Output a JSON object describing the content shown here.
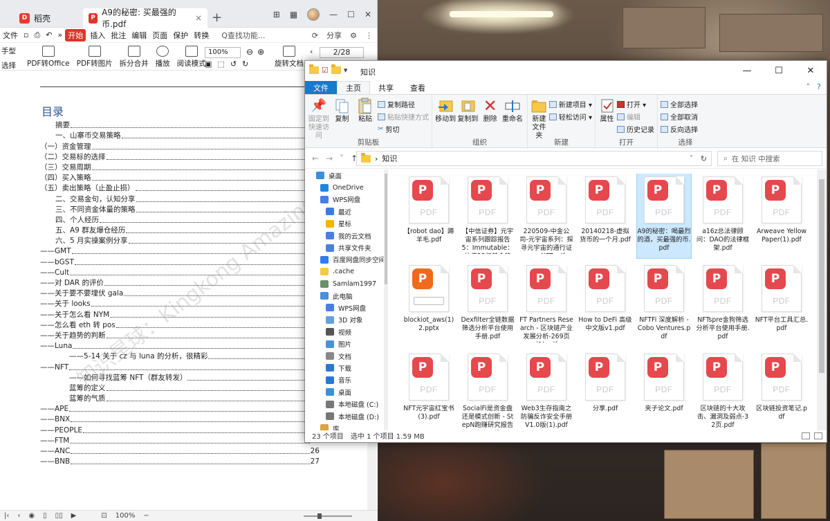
{
  "wps": {
    "tabs": [
      {
        "label": "稻壳",
        "icon": "docer-icon"
      },
      {
        "label": "A9的秘密:      买最强的币.pdf",
        "icon": "pdf-icon"
      }
    ],
    "new_tab": "+",
    "menu": {
      "file": "文件",
      "items": [
        "开始",
        "插入",
        "批注",
        "编辑",
        "页面",
        "保护",
        "转换"
      ],
      "search": "Q查找功能...",
      "share": "分享",
      "expand": "»"
    },
    "ribbon": {
      "hand": "手型",
      "select": "选择",
      "buttons": [
        "PDF转Office",
        "PDF转图片",
        "拆分合并",
        "播放",
        "阅读模式",
        "旋转文档"
      ],
      "zoom": "100%",
      "page": "2/28"
    },
    "doc": {
      "toc_title": "目录",
      "toc": [
        {
          "text": "摘要",
          "indent": 2,
          "page": ""
        },
        {
          "text": "一、山寨币交易策略",
          "indent": 2,
          "page": ""
        },
        {
          "text": "（一）资金管理",
          "indent": 0,
          "page": ""
        },
        {
          "text": "（二）交易标的选择",
          "indent": 0,
          "page": ""
        },
        {
          "text": "（三）交易周期",
          "indent": 0,
          "page": ""
        },
        {
          "text": "（四）买入策略",
          "indent": 0,
          "page": ""
        },
        {
          "text": "（五）卖出策略（止盈止损）",
          "indent": 0,
          "page": ""
        },
        {
          "text": "二、交易金句，认知分享",
          "indent": 2,
          "page": ""
        },
        {
          "text": "三、不同资金体量的策略",
          "indent": 2,
          "page": ""
        },
        {
          "text": "四、个人经历",
          "indent": 2,
          "page": ""
        },
        {
          "text": "五、A9 群友爆仓经历",
          "indent": 2,
          "page": ""
        },
        {
          "text": "六、5 月实操案例分享",
          "indent": 2,
          "page": ""
        },
        {
          "text": "——GMT",
          "indent": 0,
          "page": ""
        },
        {
          "text": "——bGST",
          "indent": 0,
          "page": ""
        },
        {
          "text": "——Cult",
          "indent": 0,
          "page": ""
        },
        {
          "text": "——对 DAR 的评价",
          "indent": 0,
          "page": ""
        },
        {
          "text": "——关于要不要埋伏 gala",
          "indent": 0,
          "page": ""
        },
        {
          "text": "——关于 looks",
          "indent": 0,
          "page": ""
        },
        {
          "text": "——关于怎么看 NYM",
          "indent": 0,
          "page": ""
        },
        {
          "text": "——怎么看 eth 转 pos",
          "indent": 0,
          "page": ""
        },
        {
          "text": "——关于趋势的判断",
          "indent": 0,
          "page": ""
        },
        {
          "text": "——Luna",
          "indent": 0,
          "page": ""
        },
        {
          "text": "——5-14  关于 cz 与 luna 的分析，很精彩",
          "indent": 1,
          "page": ""
        },
        {
          "text": "——NFT",
          "indent": 0,
          "page": ""
        },
        {
          "text": "——如何寻找蓝筹 NFT（群友转发）",
          "indent": 1,
          "page": ""
        },
        {
          "text": "蓝筹的定义",
          "indent": 3,
          "page": ""
        },
        {
          "text": "蓝筹的气质",
          "indent": 3,
          "page": ""
        },
        {
          "text": "——APE",
          "indent": 0,
          "page": ""
        },
        {
          "text": "——BNX",
          "indent": 0,
          "page": ""
        },
        {
          "text": "——PEOPLE",
          "indent": 0,
          "page": ""
        },
        {
          "text": "——FTM",
          "indent": 0,
          "page": ""
        },
        {
          "text": "——ANC",
          "indent": 0,
          "page": "26"
        },
        {
          "text": "——BNB",
          "indent": 0,
          "page": "27"
        }
      ],
      "watermark": "知识星球：Kingkong Amazing24"
    },
    "status": {
      "zoom": "100%"
    }
  },
  "explorer": {
    "title": "知识",
    "tabs": [
      "文件",
      "主页",
      "共享",
      "查看"
    ],
    "groups": {
      "clipboard": {
        "label": "剪贴板",
        "pin": "固定到快速访问",
        "copy": "复制",
        "paste": "粘贴",
        "copy_path": "复制路径",
        "paste_shortcut": "粘贴快捷方式",
        "cut": "剪切"
      },
      "organize": {
        "label": "组织",
        "move": "移动到",
        "copy_to": "复制到",
        "delete": "删除",
        "rename": "重命名"
      },
      "new": {
        "label": "新建",
        "new_folder": "新建文件夹",
        "new_item": "新建项目 ▾",
        "easy_access": "轻松访问 ▾"
      },
      "open": {
        "label": "打开",
        "properties": "属性",
        "open": "打开 ▾",
        "edit": "编辑",
        "history": "历史记录"
      },
      "select": {
        "label": "选择",
        "select_all": "全部选择",
        "select_none": "全部取消",
        "invert": "反向选择"
      }
    },
    "address": {
      "path": "知识",
      "search_placeholder": "在 知识 中搜索"
    },
    "nav": [
      {
        "label": "桌面",
        "icon": "desktop-icon",
        "color": "#3b8fd9",
        "indent": 0
      },
      {
        "label": "OneDrive",
        "icon": "onedrive-icon",
        "color": "#1e86e0",
        "indent": 1
      },
      {
        "label": "WPS网盘",
        "icon": "cloud-icon",
        "color": "#4a7fe0",
        "indent": 1
      },
      {
        "label": "最近",
        "icon": "recent-icon",
        "color": "#3a7be0",
        "indent": 2
      },
      {
        "label": "星标",
        "icon": "star-icon",
        "color": "#f5b400",
        "indent": 2
      },
      {
        "label": "我的云文档",
        "icon": "cloud-doc-icon",
        "color": "#4a7fe0",
        "indent": 2
      },
      {
        "label": "共享文件夹",
        "icon": "shared-folder-icon",
        "color": "#4a7fe0",
        "indent": 2
      },
      {
        "label": "百度网盘同步空间",
        "icon": "baidu-icon",
        "color": "#2f7cf6",
        "indent": 1
      },
      {
        "label": ".cache",
        "icon": "folder-icon",
        "color": "#f7c948",
        "indent": 1
      },
      {
        "label": "Samlam1997",
        "icon": "user-icon",
        "color": "#6b8e6b",
        "indent": 1
      },
      {
        "label": "此电脑",
        "icon": "computer-icon",
        "color": "#4a90d9",
        "indent": 1
      },
      {
        "label": "WPS网盘",
        "icon": "cloud-icon",
        "color": "#4a7fe0",
        "indent": 2
      },
      {
        "label": "3D 对象",
        "icon": "3d-icon",
        "color": "#62a0e0",
        "indent": 2
      },
      {
        "label": "视频",
        "icon": "video-icon",
        "color": "#555",
        "indent": 2
      },
      {
        "label": "图片",
        "icon": "picture-icon",
        "color": "#4a90d9",
        "indent": 2
      },
      {
        "label": "文档",
        "icon": "document-icon",
        "color": "#888",
        "indent": 2
      },
      {
        "label": "下载",
        "icon": "download-icon",
        "color": "#2a78d0",
        "indent": 2
      },
      {
        "label": "音乐",
        "icon": "music-icon",
        "color": "#2a78d0",
        "indent": 2
      },
      {
        "label": "桌面",
        "icon": "desktop-icon",
        "color": "#3b8fd9",
        "indent": 2
      },
      {
        "label": "本地磁盘 (C:)",
        "icon": "drive-icon",
        "color": "#777",
        "indent": 2
      },
      {
        "label": "本地磁盘 (D:)",
        "icon": "drive-icon",
        "color": "#777",
        "indent": 2
      },
      {
        "label": "库",
        "icon": "library-icon",
        "color": "#d9a441",
        "indent": 1
      }
    ],
    "files": [
      {
        "name": "【robot dao】蹲羊毛.pdf",
        "type": "pdf",
        "selected": false
      },
      {
        "name": "【中信证券】元宇宙系列跟踪报告5：Immutable：估值25亿美金的N...",
        "type": "pdf",
        "selected": false
      },
      {
        "name": "220509-中金公司-元宇宙系列：探寻元宇宙的通行证——NFT.pdf",
        "type": "pdf",
        "selected": false
      },
      {
        "name": "20140218-虚拟货币的一个月.pdf",
        "type": "pdf",
        "selected": false
      },
      {
        "name": "A9的秘密：喝最烈的酒，买最强的币.pdf",
        "type": "pdf",
        "selected": true
      },
      {
        "name": "a16z总法律顾问：DAO的法律框架.pdf",
        "type": "pdf",
        "selected": false
      },
      {
        "name": "Arweave Yellow Paper(1).pdf",
        "type": "pdf",
        "selected": false
      },
      {
        "name": "blockiot_aws(1)2.pptx",
        "type": "pptx",
        "selected": false
      },
      {
        "name": "Dexfilter全链数据筛选分析平台使用手册.pdf",
        "type": "pdf",
        "selected": false
      },
      {
        "name": "FT Partners Research - 区块链产业发展分析-269页(1).pdf",
        "type": "pdf",
        "selected": false
      },
      {
        "name": "How to DeFi 高级中文版v1.pdf",
        "type": "pdf",
        "selected": false
      },
      {
        "name": "NFTFi 深度解析 - Cobo Ventures.pdf",
        "type": "pdf",
        "selected": false
      },
      {
        "name": "NFTspre金狗筛选分析平台使用手册.pdf",
        "type": "pdf",
        "selected": false
      },
      {
        "name": "NFT平台工具汇总.pdf",
        "type": "pdf",
        "selected": false
      },
      {
        "name": "NFT元宇宙红宝书(3).pdf",
        "type": "pdf",
        "selected": false
      },
      {
        "name": "SocialFi是资金盘还是模式创新 - StepN跑赚研究报告(1).pdf",
        "type": "pdf",
        "selected": false
      },
      {
        "name": "Web3生存指南之防骗反诈安全手册V1.0版(1).pdf",
        "type": "pdf",
        "selected": false
      },
      {
        "name": "分享.pdf",
        "type": "pdf",
        "selected": false
      },
      {
        "name": "夹子论文.pdf",
        "type": "pdf",
        "selected": false
      },
      {
        "name": "区块链的十大攻击、漏洞及弱点-32页.pdf",
        "type": "pdf",
        "selected": false
      },
      {
        "name": "区块链投资笔记.pdf",
        "type": "pdf",
        "selected": false
      }
    ],
    "status": {
      "count": "23 个项目",
      "selection": "选中 1 个项目  1.59 MB"
    }
  }
}
